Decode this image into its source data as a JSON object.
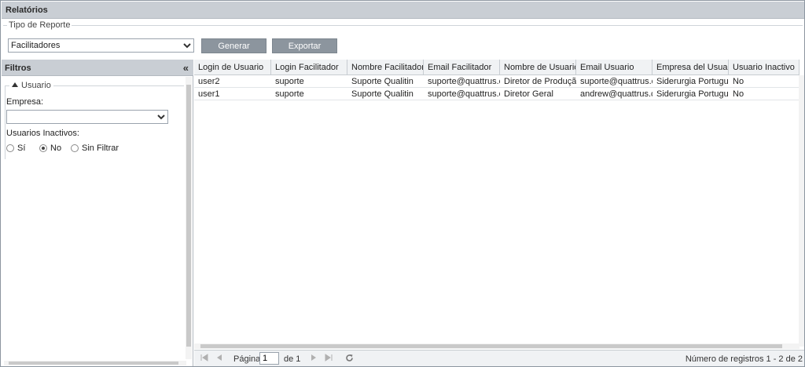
{
  "window": {
    "title": "Relatórios"
  },
  "report": {
    "legend": "Tipo de Reporte",
    "selected": "Facilitadores",
    "generate_label": "Generar",
    "export_label": "Exportar"
  },
  "filters": {
    "title": "Filtros",
    "collapse_glyph": "«",
    "group_label": "Usuario",
    "empresa_label": "Empresa:",
    "empresa_value": "",
    "inactive_label": "Usuarios Inactivos:",
    "options": [
      {
        "label": "Sí",
        "checked": false
      },
      {
        "label": "No",
        "checked": true
      },
      {
        "label": "Sin Filtrar",
        "checked": false
      }
    ]
  },
  "grid": {
    "columns": [
      "Login de Usuario",
      "Login Facilitador",
      "Nombre Facilitador",
      "Email Facilitador",
      "Nombre de Usuario",
      "Email Usuario",
      "Empresa del Usuario",
      "Usuario Inactivo"
    ],
    "rows": [
      [
        "user2",
        "suporte",
        "Suporte Qualitin",
        "suporte@quattrus.c...",
        "Diretor de Produção",
        "suporte@quattrus.c...",
        "Siderurgia Português",
        "No"
      ],
      [
        "user1",
        "suporte",
        "Suporte Qualitin",
        "suporte@quattrus.c...",
        "Diretor Geral",
        "andrew@quattrus.c...",
        "Siderurgia Português",
        "No"
      ]
    ]
  },
  "pager": {
    "page_label": "Página",
    "page_value": "1",
    "of_label": "de 1",
    "records_label": "Número de registros 1 - 2 de 2"
  }
}
